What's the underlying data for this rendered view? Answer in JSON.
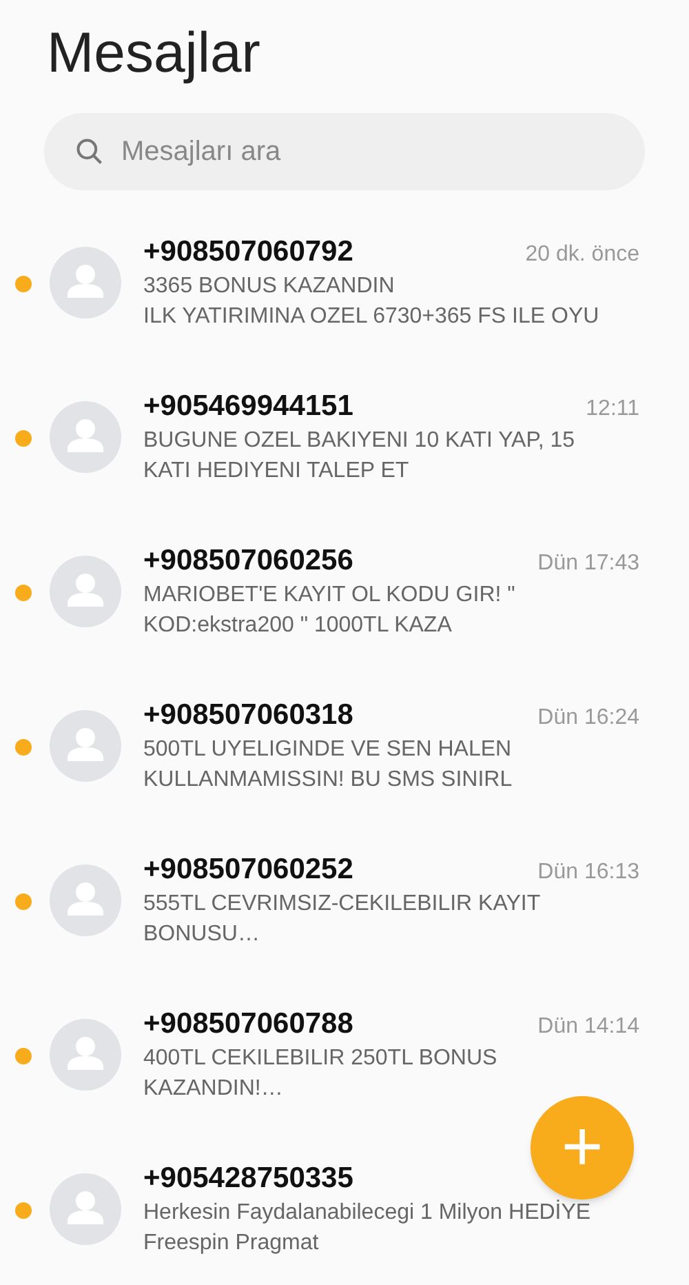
{
  "title": "Mesajlar",
  "search": {
    "placeholder": "Mesajları ara"
  },
  "conversations": [
    {
      "sender": "+908507060792",
      "time": "20 dk. önce",
      "unread": true,
      "preview_lines": [
        "3365 BONUS KAZANDIN",
        "ILK YATIRIMINA OZEL 6730+365 FS ILE OYU"
      ]
    },
    {
      "sender": "+905469944151",
      "time": "12:11",
      "unread": true,
      "preview_lines": [
        "BUGUNE OZEL BAKIYENI 10 KATI YAP, 15",
        "KATI HEDIYENI TALEP ET"
      ]
    },
    {
      "sender": "+908507060256",
      "time": "Dün 17:43",
      "unread": true,
      "preview_lines": [
        "MARIOBET'E KAYIT OL KODU GIR! \"",
        "KOD:ekstra200 \" 1000TL KAZA"
      ]
    },
    {
      "sender": "+908507060318",
      "time": "Dün 16:24",
      "unread": true,
      "preview_lines": [
        "500TL UYELIGINDE VE SEN HALEN",
        "KULLANMAMISSIN! BU SMS SINIRL"
      ]
    },
    {
      "sender": "+908507060252",
      "time": "Dün 16:13",
      "unread": true,
      "preview_lines": [
        "555TL CEVRIMSIZ-CEKILEBILIR KAYIT",
        "BONUSU…"
      ]
    },
    {
      "sender": "+908507060788",
      "time": "Dün 14:14",
      "unread": true,
      "preview_lines": [
        "400TL CEKILEBILIR 250TL BONUS",
        "KAZANDIN!…"
      ]
    },
    {
      "sender": "+905428750335",
      "unread": true,
      "preview_lines": [
        "Herkesin Faydalanabilecegi 1 Milyon HEDİYE",
        "Freespin Pragmat"
      ]
    }
  ],
  "compose_button": {
    "label": "+"
  }
}
